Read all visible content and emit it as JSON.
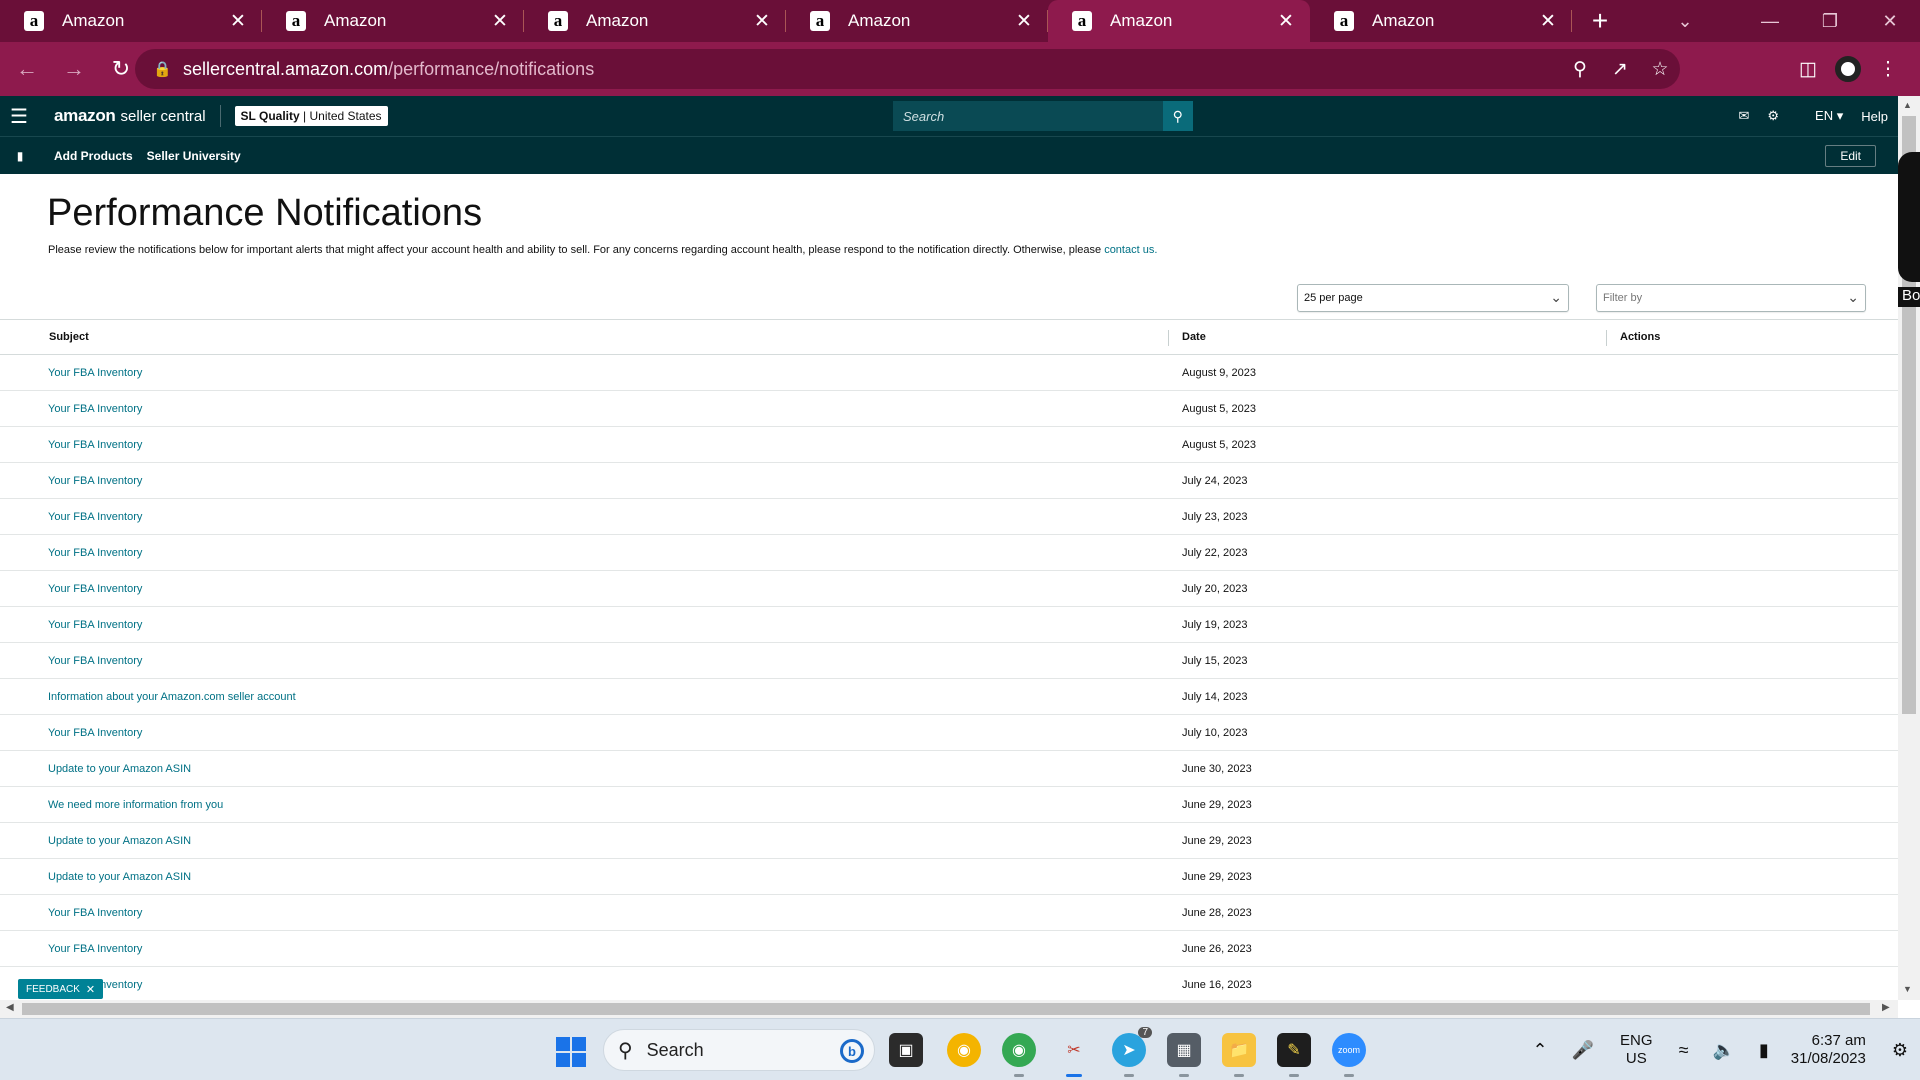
{
  "browser": {
    "tabs": [
      {
        "title": "Amazon",
        "active": false
      },
      {
        "title": "Amazon",
        "active": false
      },
      {
        "title": "Amazon",
        "active": false
      },
      {
        "title": "Amazon",
        "active": false
      },
      {
        "title": "Amazon",
        "active": true
      },
      {
        "title": "Amazon",
        "active": false
      }
    ],
    "url_host": "sellercentral.amazon.com",
    "url_path": "/performance/notifications",
    "theme_color": "#8e1a4d"
  },
  "header": {
    "brand": "amazon",
    "brand_suffix": "seller central",
    "account_name": "SL Quality",
    "account_region": "United States",
    "search_placeholder": "Search",
    "language": "EN",
    "help": "Help"
  },
  "subnav": {
    "links": [
      "Add Products",
      "Seller University"
    ],
    "edit_label": "Edit"
  },
  "page": {
    "title": "Performance Notifications",
    "intro": "Please review the notifications below for important alerts that might affect your account health and ability to sell. For any concerns regarding account health, please respond to the notification directly. Otherwise, please",
    "intro_link": "contact us.",
    "per_page": "25 per page",
    "filter_placeholder": "Filter by",
    "columns": [
      "Subject",
      "Date",
      "Actions"
    ],
    "rows": [
      {
        "subject": "Your FBA Inventory",
        "date": "August 9, 2023"
      },
      {
        "subject": "Your FBA Inventory",
        "date": "August 5, 2023"
      },
      {
        "subject": "Your FBA Inventory",
        "date": "August 5, 2023"
      },
      {
        "subject": "Your FBA Inventory",
        "date": "July 24, 2023"
      },
      {
        "subject": "Your FBA Inventory",
        "date": "July 23, 2023"
      },
      {
        "subject": "Your FBA Inventory",
        "date": "July 22, 2023"
      },
      {
        "subject": "Your FBA Inventory",
        "date": "July 20, 2023"
      },
      {
        "subject": "Your FBA Inventory",
        "date": "July 19, 2023"
      },
      {
        "subject": "Your FBA Inventory",
        "date": "July 15, 2023"
      },
      {
        "subject": "Information about your Amazon.com seller account",
        "date": "July 14, 2023"
      },
      {
        "subject": "Your FBA Inventory",
        "date": "July 10, 2023"
      },
      {
        "subject": "Update to your Amazon ASIN",
        "date": "June 30, 2023"
      },
      {
        "subject": "We need more information from you",
        "date": "June 29, 2023"
      },
      {
        "subject": "Update to your Amazon ASIN",
        "date": "June 29, 2023"
      },
      {
        "subject": "Update to your Amazon ASIN",
        "date": "June 29, 2023"
      },
      {
        "subject": "Your FBA Inventory",
        "date": "June 28, 2023"
      },
      {
        "subject": "Your FBA Inventory",
        "date": "June 26, 2023"
      },
      {
        "subject": "Your FBA Inventory",
        "date": "June 16, 2023"
      }
    ],
    "feedback_label": "FEEDBACK",
    "side_text": "Bo"
  },
  "taskbar": {
    "search_label": "Search",
    "telegram_badge": "7",
    "lang_top": "ENG",
    "lang_bottom": "US",
    "time": "6:37 am",
    "date": "31/08/2023"
  }
}
